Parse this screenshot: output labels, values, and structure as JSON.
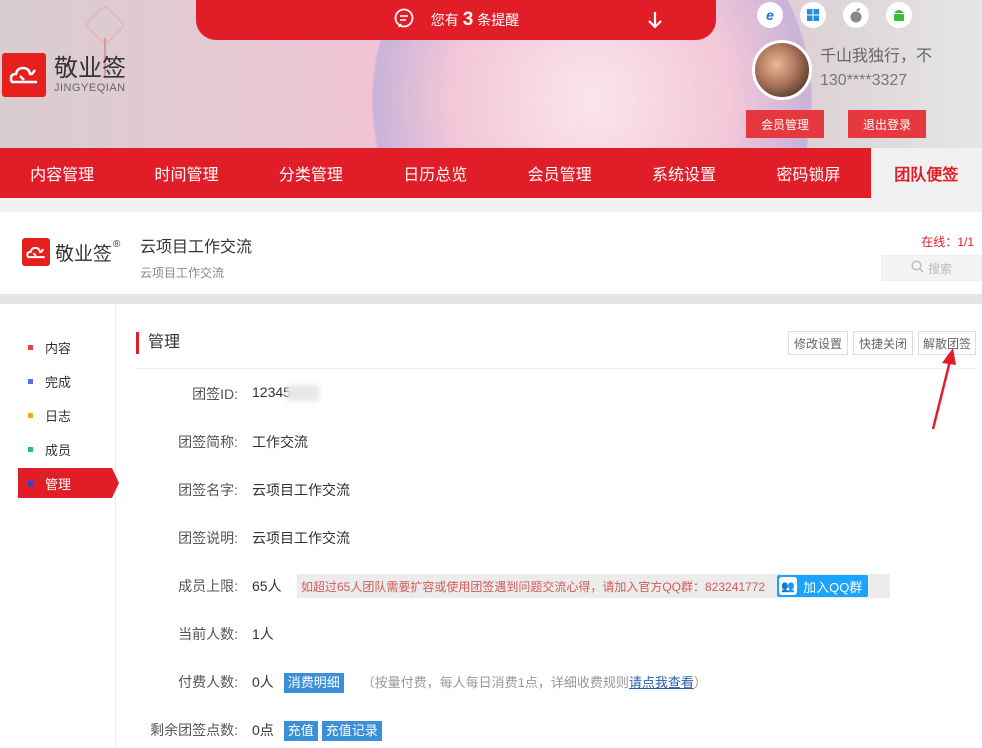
{
  "header": {
    "logo_cn": "敬业签",
    "logo_en": "JINGYEQIAN",
    "remind_prefix": "您有",
    "remind_count": "3",
    "remind_suffix": "条提醒",
    "platforms": [
      "ie-icon",
      "windows-icon",
      "apple-icon",
      "android-icon"
    ],
    "username": "千山我独行，不",
    "phone": "130****3327",
    "member_btn": "会员管理",
    "logout_btn": "退出登录"
  },
  "nav": {
    "items": [
      "内容管理",
      "时间管理",
      "分类管理",
      "日历总览",
      "会员管理",
      "系统设置",
      "密码锁屏",
      "团队便签"
    ],
    "active": "团队便签"
  },
  "team": {
    "logo_text": "敬业签",
    "reg": "®",
    "title": "云项目工作交流",
    "subtitle": "云项目工作交流",
    "online_label": "在线：",
    "online_value": "1/1",
    "search_placeholder": "搜索"
  },
  "sidebar": {
    "items": [
      {
        "label": "内容",
        "color": "#e04646"
      },
      {
        "label": "完成",
        "color": "#5470e8"
      },
      {
        "label": "日志",
        "color": "#f0b400"
      },
      {
        "label": "成员",
        "color": "#20c07a"
      },
      {
        "label": "管理",
        "color": "#2244ee"
      }
    ]
  },
  "main": {
    "title": "管理",
    "buttons": [
      "修改设置",
      "快捷关闭",
      "解散团签"
    ],
    "rows": {
      "id_label": "团签ID:",
      "id_value": "12345",
      "short_label": "团签简称:",
      "short_value": "工作交流",
      "name_label": "团签名字:",
      "name_value": "云项目工作交流",
      "desc_label": "团签说明:",
      "desc_value": "云项目工作交流",
      "limit_label": "成员上限:",
      "limit_value": "65人",
      "limit_notice": "如超过65人团队需要扩容或使用团签遇到问题交流心得，请加入官方QQ群：823241772",
      "qq_btn": "加入QQ群",
      "current_label": "当前人数:",
      "current_value": "1人",
      "paid_label": "付费人数:",
      "paid_value": "0人",
      "paid_detail_btn": "消费明细",
      "paid_note_prefix": "（按量付费，每人每日消费1点，详细收费规则",
      "paid_note_link": "请点我查看",
      "paid_note_suffix": "）",
      "points_label": "剩余团签点数:",
      "points_value": "0点",
      "recharge_btn": "充值",
      "recharge_log_btn": "充值记录"
    }
  },
  "colors": {
    "brand_red": "#e11d28",
    "link_blue": "#2a5fa8",
    "btn_blue": "#3b8ed8"
  }
}
